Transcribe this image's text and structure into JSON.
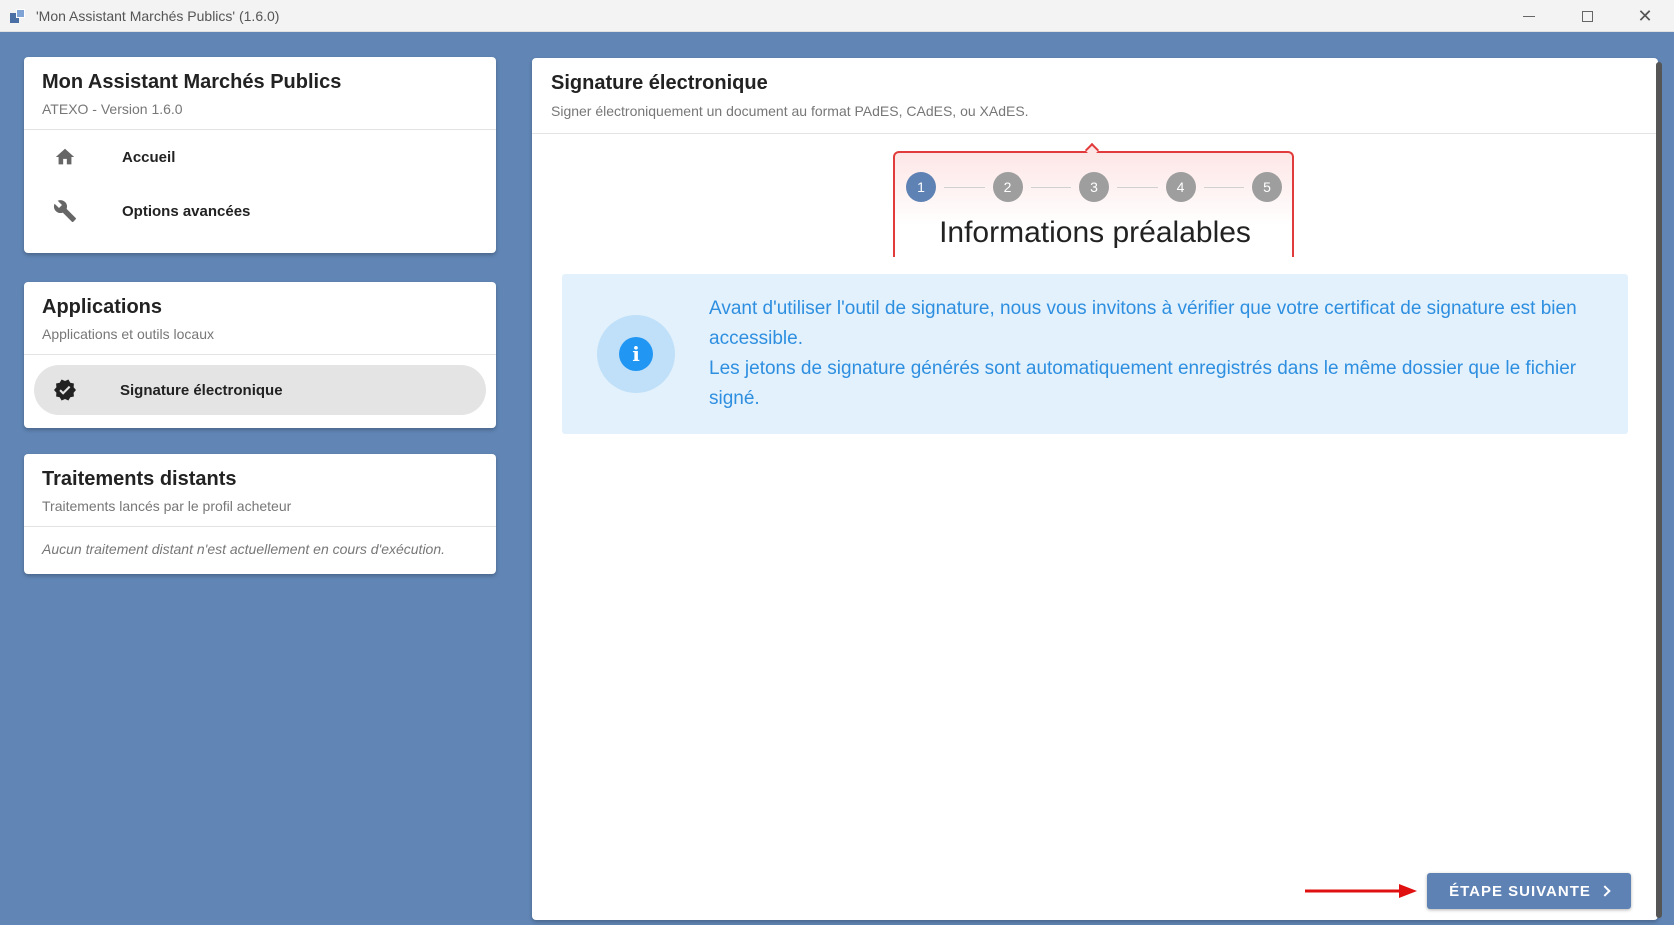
{
  "window": {
    "title": "'Mon Assistant Marchés Publics' (1.6.0)"
  },
  "sidebar": {
    "app_card": {
      "title": "Mon Assistant Marchés Publics",
      "subtitle": "ATEXO - Version 1.6.0",
      "items": [
        {
          "label": "Accueil",
          "icon": "home-icon"
        },
        {
          "label": "Options avancées",
          "icon": "wrench-icon"
        }
      ]
    },
    "applications_card": {
      "title": "Applications",
      "subtitle": "Applications et outils locaux",
      "items": [
        {
          "label": "Signature électronique",
          "icon": "verified-badge-icon",
          "selected": true
        }
      ]
    },
    "remote_card": {
      "title": "Traitements distants",
      "subtitle": "Traitements lancés par le profil acheteur",
      "empty_message": "Aucun traitement distant n'est actuellement en cours d'exécution."
    }
  },
  "main": {
    "title": "Signature électronique",
    "subtitle": "Signer électroniquement un document au format PAdES, CAdES, ou XAdES.",
    "steps": [
      "1",
      "2",
      "3",
      "4",
      "5"
    ],
    "active_step": 1,
    "step_heading": "Informations préalables",
    "info": {
      "icon": "info-icon",
      "line1": "Avant d'utiliser l'outil de signature, nous vous invitons à vérifier que votre certificat de signature est bien accessible.",
      "line2": "Les jetons de signature générés sont automatiquement enregistrés dans le même dossier que le fichier signé."
    },
    "next_button": "ÉTAPE SUIVANTE"
  },
  "colors": {
    "background": "#6186b6",
    "accent": "#5f82b4",
    "info_text": "#2e8fe0",
    "info_bg": "#e3f1fc",
    "highlight_red": "#e23b3b"
  }
}
